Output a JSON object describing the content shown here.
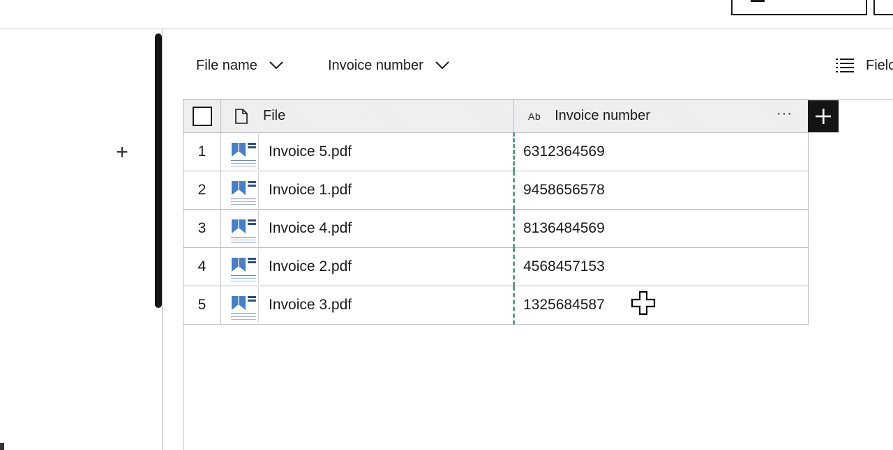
{
  "filters": [
    {
      "label": "File name",
      "icon": "chevron-down-icon"
    },
    {
      "label": "Invoice number",
      "icon": "chevron-down-icon"
    }
  ],
  "fields_button": {
    "label": "Fielc",
    "icon": "list-icon"
  },
  "table": {
    "columns": [
      {
        "label": "File",
        "icon": "file-icon"
      },
      {
        "label": "Invoice number",
        "type_badge": "Ab",
        "menu": "···"
      }
    ],
    "rows": [
      {
        "index": "1",
        "file": "Invoice 5.pdf",
        "invoice_number": "6312364569"
      },
      {
        "index": "2",
        "file": "Invoice 1.pdf",
        "invoice_number": "9458656578"
      },
      {
        "index": "3",
        "file": "Invoice 4.pdf",
        "invoice_number": "8136484569"
      },
      {
        "index": "4",
        "file": "Invoice 2.pdf",
        "invoice_number": "4568457153"
      },
      {
        "index": "5",
        "file": "Invoice 3.pdf",
        "invoice_number": "1325684587"
      }
    ]
  },
  "colors": {
    "accent_dark": "#141414",
    "column_marker": "#5f9b86",
    "thumb_logo": "#4a7fc1"
  }
}
